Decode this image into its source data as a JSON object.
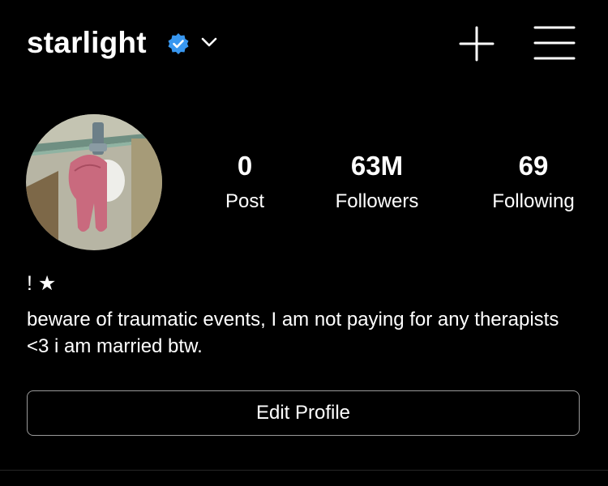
{
  "header": {
    "username": "starlight",
    "verified_icon": "verified-badge-icon",
    "dropdown_icon": "chevron-down-icon",
    "new_post_icon": "plus-icon",
    "menu_icon": "hamburger-menu-icon"
  },
  "profile": {
    "avatar_icon": "profile-avatar",
    "stats": {
      "posts": {
        "value": "0",
        "label": "Post"
      },
      "followers": {
        "value": "63M",
        "label": "Followers"
      },
      "following": {
        "value": "69",
        "label": "Following"
      }
    }
  },
  "bio": {
    "name": "! ★",
    "text": "beware of traumatic events, I am not paying for any therapists <3 i am married btw."
  },
  "actions": {
    "edit_profile_label": "Edit Profile"
  },
  "colors": {
    "background": "#000000",
    "text": "#ffffff",
    "verified": "#3897f0",
    "button_border": "#9a9a9a"
  }
}
